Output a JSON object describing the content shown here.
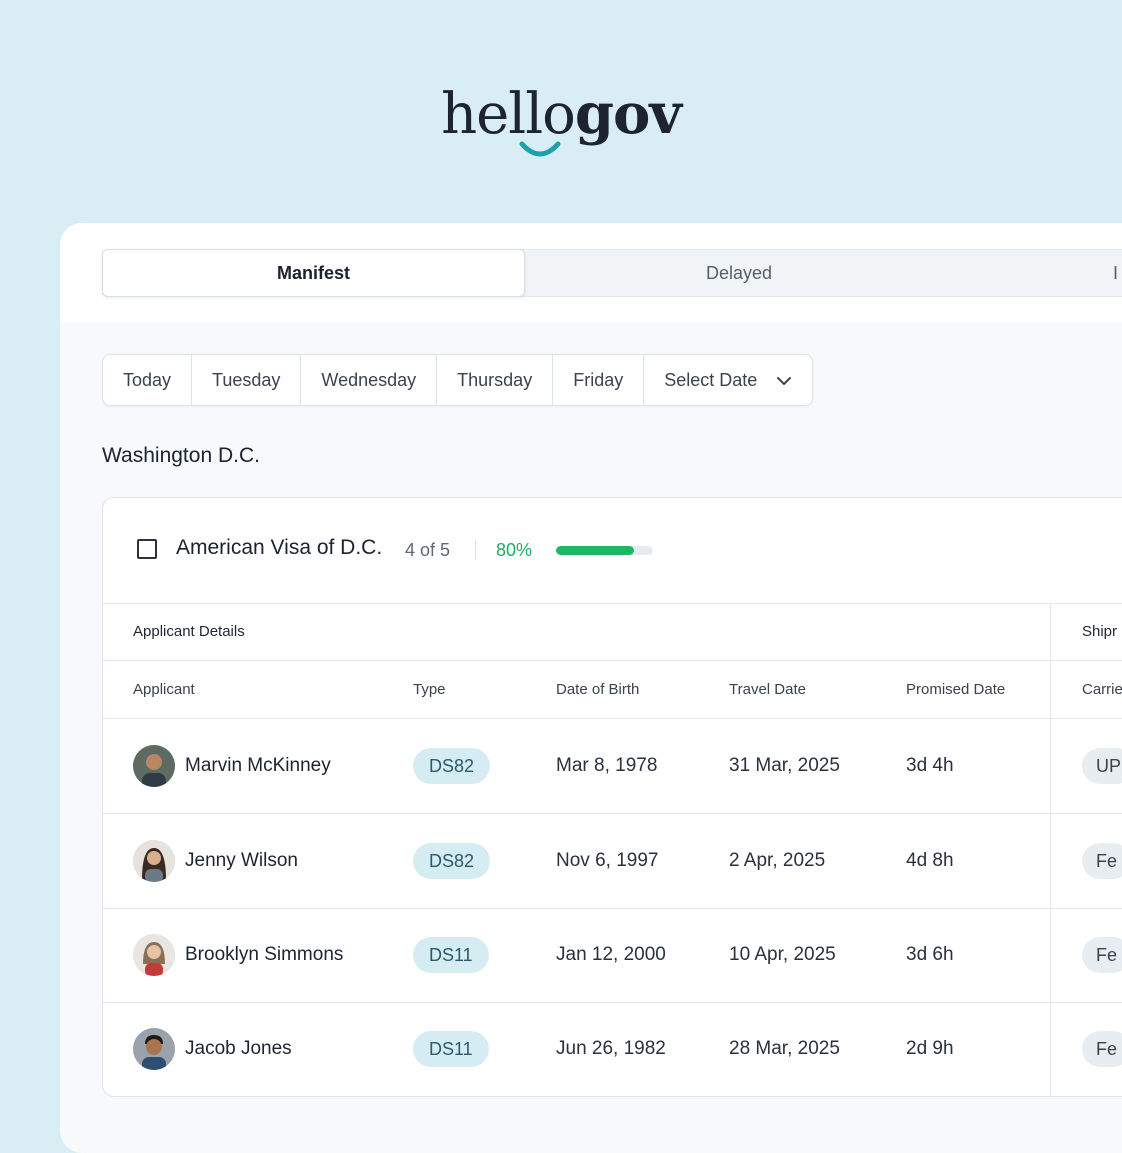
{
  "logo": {
    "light": "hello",
    "bold": "gov"
  },
  "tabs": [
    {
      "label": "Manifest",
      "active": true
    },
    {
      "label": "Delayed",
      "active": false
    },
    {
      "label": "I",
      "active": false
    }
  ],
  "date_filters": [
    "Today",
    "Tuesday",
    "Wednesday",
    "Thursday",
    "Friday",
    "Select Date"
  ],
  "city": "Washington D.C.",
  "agency": {
    "name": "American Visa of D.C.",
    "count": "4 of 5",
    "percent_label": "80%",
    "progress_fraction": 0.8,
    "progress_color": "#1fb765"
  },
  "group_headers": {
    "applicant_details": "Applicant Details",
    "shipping": "Shipr"
  },
  "columns": {
    "applicant": "Applicant",
    "type": "Type",
    "dob": "Date of Birth",
    "travel": "Travel Date",
    "promised": "Promised Date",
    "carrier": "Carrie"
  },
  "rows": [
    {
      "name": "Marvin McKinney",
      "type": "DS82",
      "dob": "Mar 8, 1978",
      "travel": "31 Mar, 2025",
      "promised": "3d 4h",
      "carrier": "UP"
    },
    {
      "name": "Jenny Wilson",
      "type": "DS82",
      "dob": "Nov 6, 1997",
      "travel": "2 Apr, 2025",
      "promised": "4d 8h",
      "carrier": "Fe"
    },
    {
      "name": "Brooklyn Simmons",
      "type": "DS11",
      "dob": "Jan 12, 2000",
      "travel": "10 Apr, 2025",
      "promised": "3d 6h",
      "carrier": "Fe"
    },
    {
      "name": "Jacob Jones",
      "type": "DS11",
      "dob": "Jun 26, 1982",
      "travel": "28 Mar, 2025",
      "promised": "2d 9h",
      "carrier": "Fe"
    }
  ],
  "colors": {
    "background": "#d8eef4",
    "badge": "#d6ecf3",
    "accent_smile": "#1ba0b0"
  }
}
